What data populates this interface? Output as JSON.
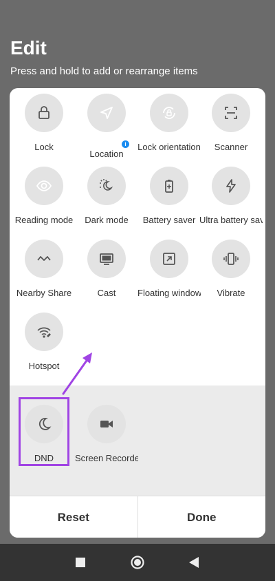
{
  "header": {
    "title": "Edit",
    "subtitle": "Press and hold to add or rearrange items"
  },
  "tiles": [
    {
      "label": "Lock",
      "icon": "lock-icon",
      "active": false
    },
    {
      "label": "Location",
      "icon": "location-arrow-icon",
      "active": true
    },
    {
      "label": "Lock orientation",
      "icon": "rotation-lock-icon",
      "active": true
    },
    {
      "label": "Scanner",
      "icon": "scanner-icon",
      "active": false
    },
    {
      "label": "Reading mode",
      "icon": "eye-icon",
      "active": true
    },
    {
      "label": "Dark mode",
      "icon": "dark-mode-icon",
      "active": false
    },
    {
      "label": "Battery saver",
      "icon": "battery-plus-icon",
      "active": false
    },
    {
      "label": "Ultra battery saver",
      "icon": "lightning-icon",
      "active": false
    },
    {
      "label": "Nearby Share",
      "icon": "nearby-share-icon",
      "active": false
    },
    {
      "label": "Cast",
      "icon": "cast-monitor-icon",
      "active": false
    },
    {
      "label": "Floating window",
      "icon": "floating-window-icon",
      "active": false
    },
    {
      "label": "Vibrate",
      "icon": "vibrate-icon",
      "active": false
    },
    {
      "label": "Hotspot",
      "icon": "hotspot-icon",
      "active": false
    }
  ],
  "tray_tiles": [
    {
      "label": "DND",
      "icon": "moon-icon",
      "active": false
    },
    {
      "label": "Screen Recorder",
      "icon": "video-camera-icon",
      "active": false
    }
  ],
  "info_badge": "i",
  "footer": {
    "reset_label": "Reset",
    "done_label": "Done"
  },
  "colors": {
    "accent": "#1a8cf0",
    "highlight": "#a044e4",
    "backdrop": "#6b6b6b"
  },
  "navbar": {
    "icons": [
      "recents-square-icon",
      "home-circle-icon",
      "back-triangle-icon"
    ]
  }
}
